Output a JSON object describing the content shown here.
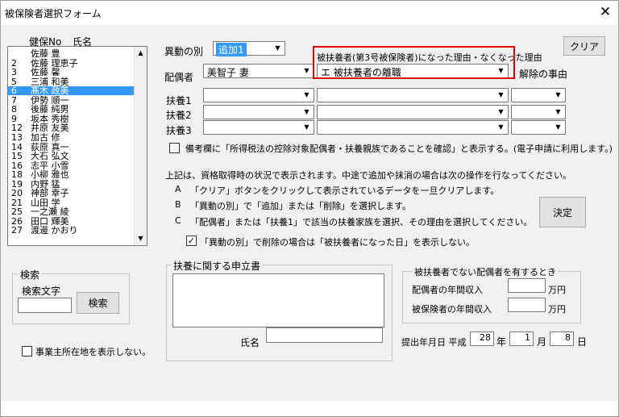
{
  "window": {
    "title": "被保険者選択フォーム",
    "close_glyph": "✕"
  },
  "list": {
    "header_no": "健保No",
    "header_name": "氏名",
    "rows": [
      {
        "no": "",
        "name": "佐藤 豊"
      },
      {
        "no": "2",
        "name": "佐藤 理恵子"
      },
      {
        "no": "3",
        "name": "佐藤 馨"
      },
      {
        "no": "5",
        "name": "三浦 和美"
      },
      {
        "no": "6",
        "name": "髙木 政美"
      },
      {
        "no": "7",
        "name": "伊勢 順一"
      },
      {
        "no": "8",
        "name": "後藤 純男"
      },
      {
        "no": "9",
        "name": "坂本 秀樹"
      },
      {
        "no": "12",
        "name": "井原 友美"
      },
      {
        "no": "13",
        "name": "加古 修"
      },
      {
        "no": "14",
        "name": "荻原 真一"
      },
      {
        "no": "15",
        "name": "大石 弘文"
      },
      {
        "no": "16",
        "name": "志平 小雪"
      },
      {
        "no": "18",
        "name": "小柳 雅也"
      },
      {
        "no": "19",
        "name": "内野 猛"
      },
      {
        "no": "20",
        "name": "神部 幸子"
      },
      {
        "no": "21",
        "name": "山田 学"
      },
      {
        "no": "25",
        "name": "一之瀬 綾"
      },
      {
        "no": "26",
        "name": "田口 輝美"
      },
      {
        "no": "27",
        "name": "渡邊 かおり"
      }
    ],
    "selected_index": 4
  },
  "form": {
    "ido_label": "異動の別",
    "ido_value": "追加1",
    "clear_label": "クリア",
    "reason_header": "被扶養者(第3号被保険者)になった理由・なくなった理由",
    "kaijo_label": "解除の事由",
    "spouse_label": "配偶者",
    "spouse_value": "美智子 妻",
    "spouse_reason": "エ 被扶養者の離職",
    "fuyo1": "扶養1",
    "fuyo2": "扶養2",
    "fuyo3": "扶養3",
    "biko_check_label": "備考欄に「所得税法の控除対象配偶者・扶養親族であることを確認」と表示する。(電子申請に利用します。)",
    "instr_intro": "上記は、資格取得時の状況で表示されます。中途で追加や抹消の場合は次の操作を行なってください。",
    "instr_a_letter": "A",
    "instr_a": "「クリア」ボタンをクリックして表示されているデータを一旦クリアします。",
    "instr_b_letter": "B",
    "instr_b": "「異動の別」で「追加」または「削除」を選択します。",
    "instr_c_letter": "C",
    "instr_c": "「配偶者」または「扶養1」で該当の扶養家族を選択、その理由を選択してください。",
    "decide_label": "決定",
    "no_show_check_label": "「異動の別」で削除の場合は「被扶養者になった日」を表示しない。",
    "no_show_checked_glyph": "✓"
  },
  "search": {
    "group_label": "検索",
    "text_label": "検索文字",
    "button": "検索"
  },
  "office_check_label": "事業主所在地を表示しない。",
  "declaration": {
    "group_label": "扶養に関する申立書",
    "name_label": "氏名"
  },
  "income": {
    "group_label": "被扶養者でない配偶者を有するとき",
    "spouse_income_label": "配偶者の年間収入",
    "insured_income_label": "被保険者の年間収入",
    "unit": "万円"
  },
  "submit_date": {
    "label": "提出年月日 平成",
    "year": "28",
    "year_unit": "年",
    "month": "1",
    "month_unit": "月",
    "day": "8",
    "day_unit": "日"
  },
  "glyphs": {
    "arrow_down": "▼",
    "arrow_up": "▲"
  }
}
